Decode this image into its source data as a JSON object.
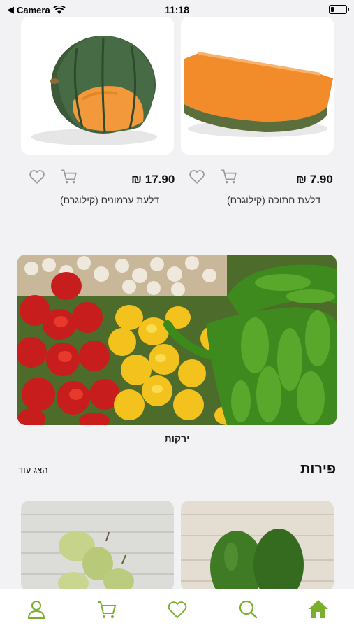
{
  "status_bar": {
    "back_app": "Camera",
    "time": "11:18",
    "battery_level": 0.2
  },
  "products": [
    {
      "name": "דלעת חתוכה (קילוגרם)",
      "price": "7.90 ₪",
      "image_icon": "pumpkin-slice-image"
    },
    {
      "name": "דלעת ערמונים (קילוגרם)",
      "price": "17.90 ₪",
      "image_icon": "acorn-squash-image"
    }
  ],
  "banner": {
    "label": "ירקות",
    "image_icon": "vegetables-image"
  },
  "fruits_section": {
    "title": "פירות",
    "show_more": "הצג עוד"
  },
  "tabbar": {
    "items": [
      "home-icon",
      "search-icon",
      "heart-icon",
      "cart-icon",
      "user-icon"
    ],
    "accent": "#7cae2e",
    "active": "home-icon"
  },
  "colors": {
    "accent": "#7cae2e",
    "background": "#f2f2f4"
  }
}
